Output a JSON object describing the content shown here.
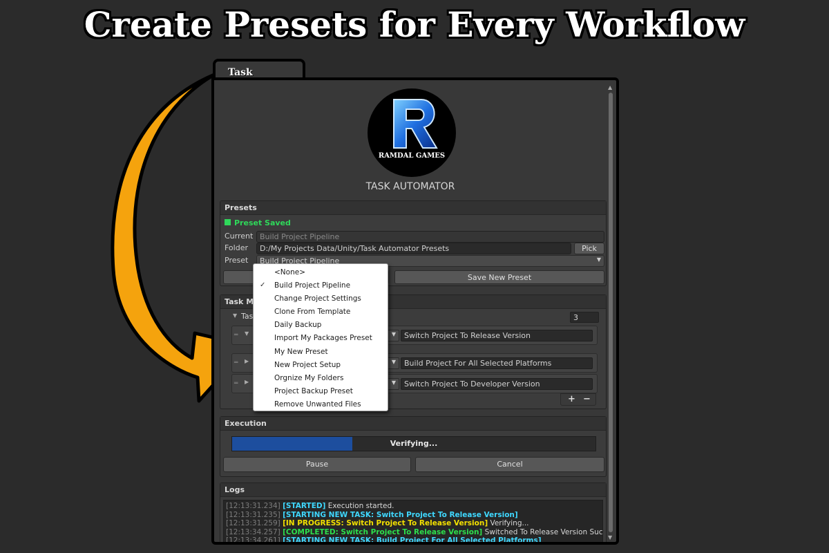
{
  "banner": {
    "title": "Create Presets for Every Workflow"
  },
  "window": {
    "tab_title": "Task Automator",
    "logo_text": "RAMDAL GAMES",
    "app_title": "TASK AUTOMATOR"
  },
  "presets": {
    "header": "Presets",
    "status": "Preset Saved",
    "current_label": "Current",
    "current_value": "Build Project Pipeline",
    "folder_label": "Folder",
    "folder_value": "D:/My Projects Data/Unity/Task Automator Presets",
    "pick_label": "Pick",
    "preset_label": "Preset",
    "preset_value": "Build Project Pipeline",
    "save_new_label": "Save New Preset"
  },
  "task_manager": {
    "header_visible": "Task Ma",
    "tasks_label_visible": "Task",
    "count": "3",
    "tasks": [
      {
        "name": "Switch Project To Release Version"
      },
      {
        "name": "Build Project For All Selected Platforms"
      },
      {
        "name": "Switch Project To Developer Version"
      }
    ],
    "plus": "+",
    "minus": "−"
  },
  "execution": {
    "header": "Execution",
    "progress_fraction": 0.33,
    "progress_text": "Verifying...",
    "pause_label": "Pause",
    "cancel_label": "Cancel"
  },
  "logs": {
    "header": "Logs",
    "lines": [
      {
        "time": "[12:13:31.234]",
        "tag": "[STARTED]",
        "tag_color": "cyan",
        "msg": "Execution started."
      },
      {
        "time": "[12:13:31.235]",
        "tag": "[STARTING NEW TASK: Switch Project To Release Version]",
        "tag_color": "cyan",
        "msg": ""
      },
      {
        "time": "[12:13:31.259]",
        "tag": "[IN PROGRESS: Switch Project To Release Version]",
        "tag_color": "yellow",
        "msg": "Verifying..."
      },
      {
        "time": "[12:13:34.257]",
        "tag": "[COMPLETED: Switch Project To Release Version]",
        "tag_color": "green",
        "msg": "Switched To Release Version Successfully."
      },
      {
        "time": "[12:13:34.261]",
        "tag": "[STARTING NEW TASK: Build Project For All Selected Platforms]",
        "tag_color": "cyan",
        "msg": ""
      }
    ]
  },
  "preset_menu": {
    "items": [
      {
        "label": "<None>",
        "checked": false
      },
      {
        "label": "Build Project Pipeline",
        "checked": true
      },
      {
        "label": "Change Project Settings",
        "checked": false
      },
      {
        "label": "Clone From Template",
        "checked": false
      },
      {
        "label": "Daily Backup",
        "checked": false
      },
      {
        "label": "Import My Packages Preset",
        "checked": false
      },
      {
        "label": "My New Preset",
        "checked": false
      },
      {
        "label": "New Project Setup",
        "checked": false
      },
      {
        "label": "Orgnize My Folders",
        "checked": false
      },
      {
        "label": "Project Backup Preset",
        "checked": false
      },
      {
        "label": "Remove Unwanted Files",
        "checked": false
      }
    ]
  },
  "colors": {
    "arrow": "#f5a30d",
    "accent_blue": "#1d4e9e",
    "status_green": "#2fd85a",
    "log_cyan": "#3fd8ff",
    "log_yellow": "#f3e000",
    "log_green": "#2ddf4c"
  }
}
